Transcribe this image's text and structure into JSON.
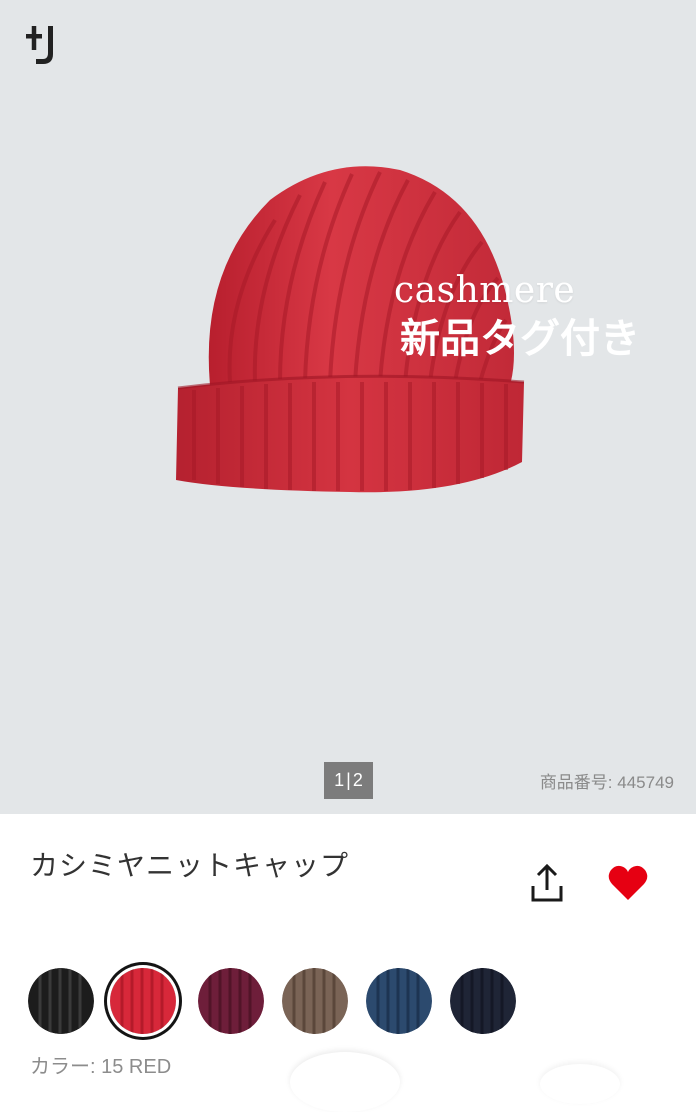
{
  "brand": {
    "logo": "+J"
  },
  "product_image": {
    "overlay_line1": "cashmere",
    "overlay_line2": "新品タグ付き"
  },
  "pager": {
    "current": "1",
    "separator": "|",
    "total": "2"
  },
  "item_number": "商品番号: 445749",
  "product_title": "カシミヤニットキャップ",
  "actions": {
    "share_icon": "share-icon",
    "favorite_icon": "heart-icon"
  },
  "colors": {
    "swatches": [
      {
        "name": "black",
        "hex": "#1c1c1c",
        "selected": false
      },
      {
        "name": "red",
        "hex": "#d7283a",
        "selected": true
      },
      {
        "name": "wine",
        "hex": "#6e1e3a",
        "selected": false
      },
      {
        "name": "brown",
        "hex": "#7a6456",
        "selected": false
      },
      {
        "name": "blue",
        "hex": "#2c4a6e",
        "selected": false
      },
      {
        "name": "navy",
        "hex": "#1f2536",
        "selected": false
      }
    ],
    "label": "カラー: 15 RED"
  },
  "accent": {
    "heart": "#e60012",
    "pager_bg": "#7c7c7c",
    "hero_bg": "#e3e6e8"
  }
}
